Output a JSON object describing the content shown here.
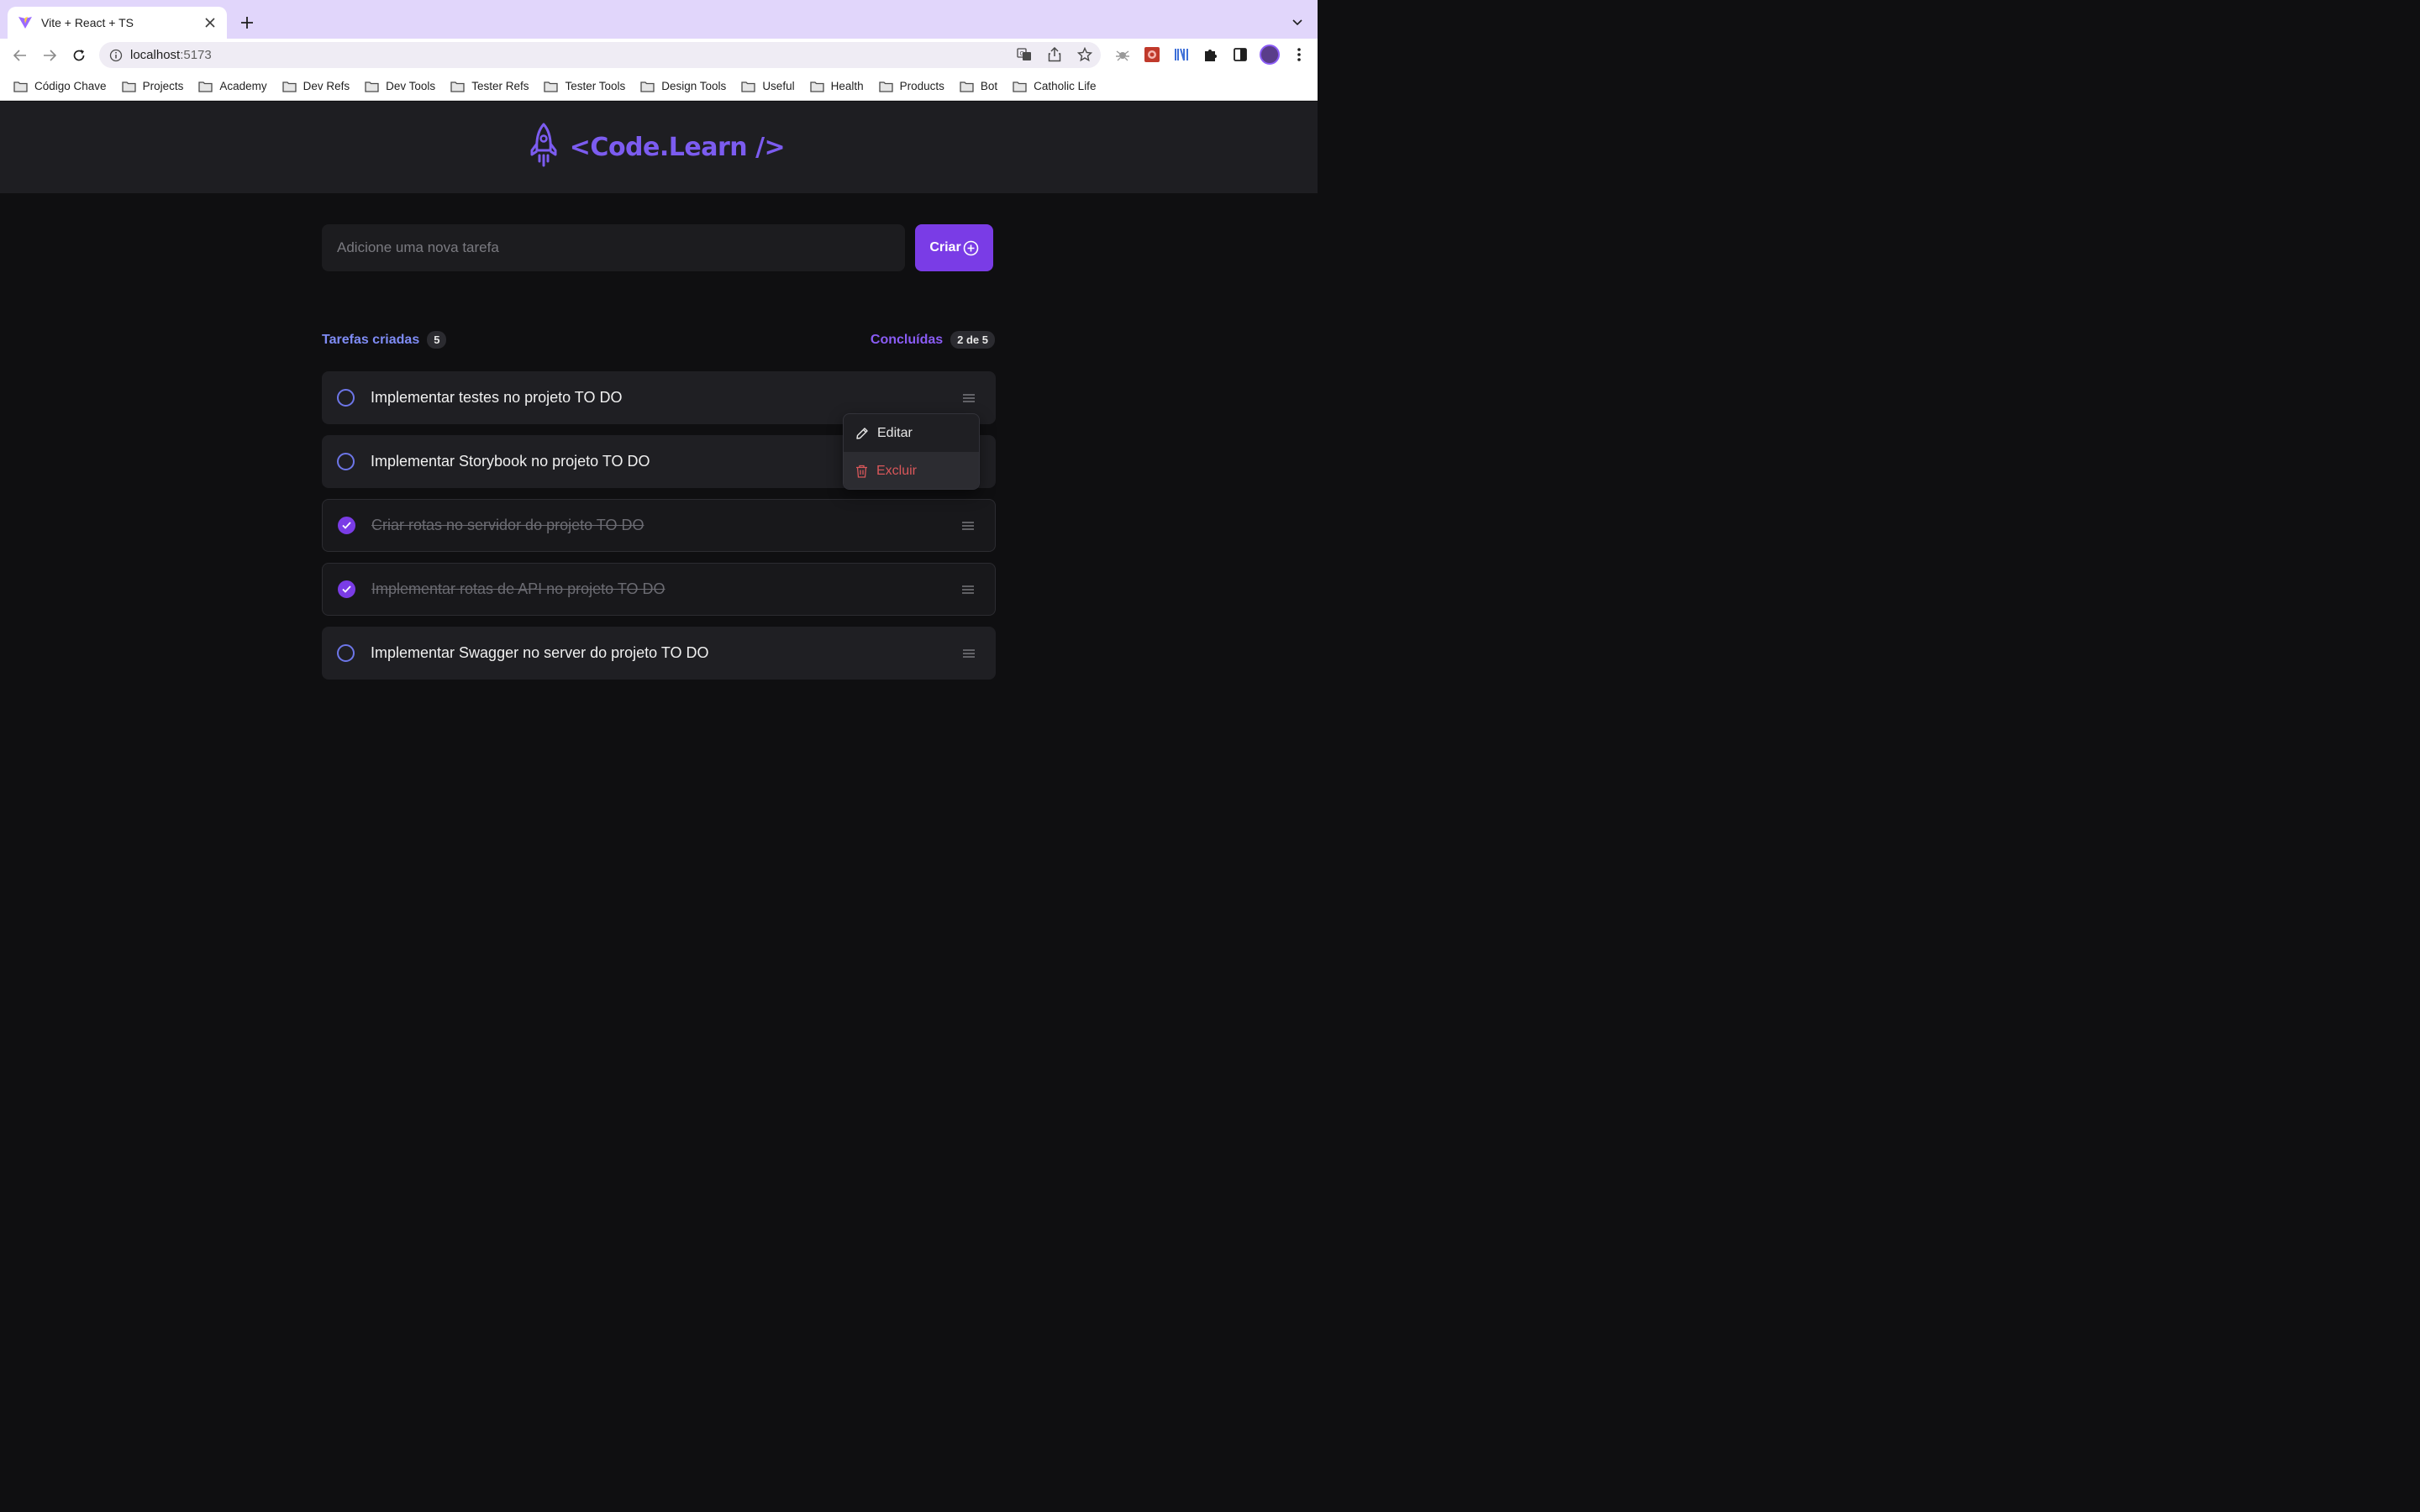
{
  "browser": {
    "tab_title": "Vite + React + TS",
    "url_host": "localhost",
    "url_port": ":5173",
    "bookmarks": [
      "Código Chave",
      "Projects",
      "Academy",
      "Dev Refs",
      "Dev Tools",
      "Tester Refs",
      "Tester Tools",
      "Design Tools",
      "Useful",
      "Health",
      "Products",
      "Bot",
      "Catholic Life"
    ]
  },
  "app": {
    "brand": "<Code.Learn />",
    "new_task_placeholder": "Adicione uma nova tarefa",
    "create_label": "Criar",
    "created_label": "Tarefas criadas",
    "created_count": "5",
    "completed_label": "Concluídas",
    "completed_count": "2 de 5",
    "tasks": [
      {
        "text": "Implementar testes no projeto TO DO",
        "done": false
      },
      {
        "text": "Implementar Storybook no projeto TO DO",
        "done": false
      },
      {
        "text": "Criar rotas no servidor do projeto TO DO",
        "done": true
      },
      {
        "text": "Implementar rotas de API no projeto TO DO",
        "done": true
      },
      {
        "text": "Implementar Swagger no server do projeto TO DO",
        "done": false
      }
    ],
    "menu": {
      "edit_label": "Editar",
      "delete_label": "Excluir"
    }
  },
  "colors": {
    "accent": "#7a3ce6",
    "brand": "#7c5cf0",
    "danger": "#d9575a",
    "created_label": "#7f8cf5"
  },
  "icons": [
    "vite-favicon",
    "close-icon",
    "plus-icon",
    "back-arrow-icon",
    "forward-arrow-icon",
    "reload-icon",
    "info-icon",
    "translate-icon",
    "share-icon",
    "star-icon",
    "puzzle-icon",
    "side-panel-icon",
    "more-vert-icon",
    "folder-icon",
    "rocket-icon",
    "plus-circle-icon",
    "check-icon",
    "menu-icon",
    "pencil-icon",
    "trash-icon"
  ]
}
